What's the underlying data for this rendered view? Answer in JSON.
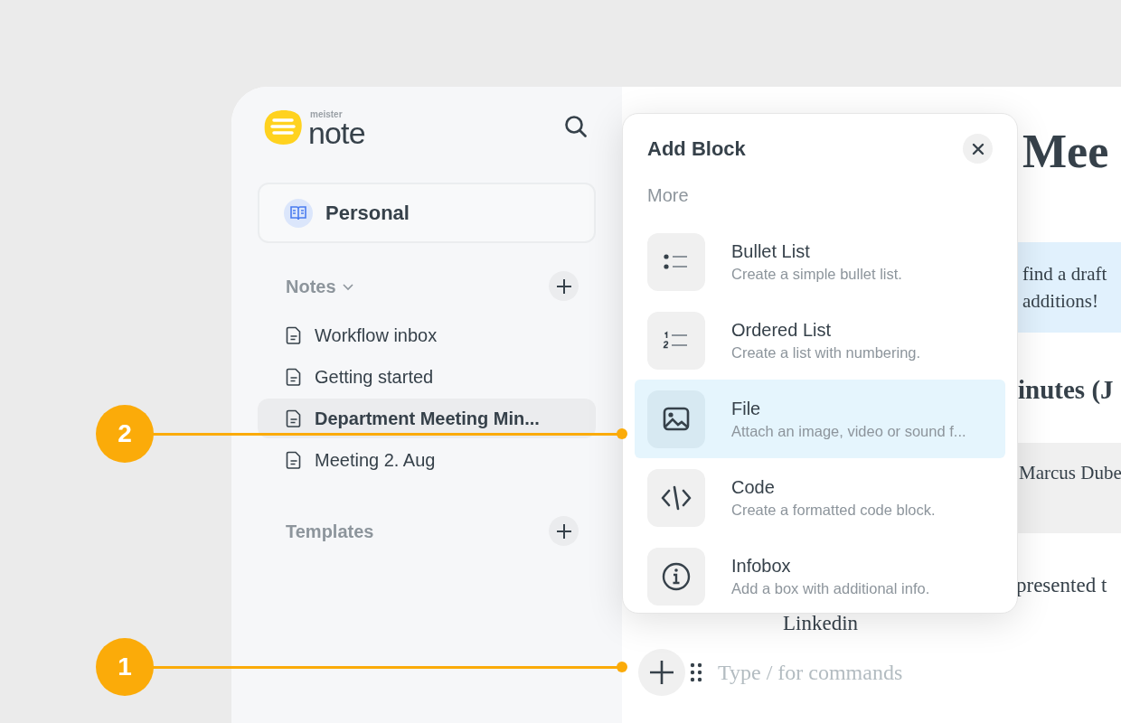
{
  "sidebar": {
    "logo": {
      "small": "meister",
      "large": "note"
    },
    "workspace": "Personal",
    "sections": [
      {
        "title": "Notes",
        "dropdown": true,
        "items": [
          {
            "label": "Workflow inbox",
            "selected": false
          },
          {
            "label": "Getting started",
            "selected": false
          },
          {
            "label": "Department Meeting Min...",
            "selected": true
          },
          {
            "label": "Meeting 2. Aug",
            "selected": false
          }
        ]
      },
      {
        "title": "Templates",
        "dropdown": false
      }
    ]
  },
  "popup": {
    "title": "Add Block",
    "section": "More",
    "items": [
      {
        "kind": "bullet",
        "title": "Bullet List",
        "description": "Create a simple bullet list.",
        "selected": false
      },
      {
        "kind": "ordered",
        "title": "Ordered List",
        "description": "Create a list with numbering.",
        "selected": false
      },
      {
        "kind": "file",
        "title": "File",
        "description": "Attach an image, video or sound f...",
        "selected": true
      },
      {
        "kind": "code",
        "title": "Code",
        "description": "Create a formatted code block.",
        "selected": false
      },
      {
        "kind": "info",
        "title": "Infobox",
        "description": "Add a box with additional info.",
        "selected": false
      }
    ]
  },
  "editor": {
    "title": "Mee",
    "infobox": [
      "find a draft",
      "additions!"
    ],
    "heading": "inutes (J",
    "table_cell": "Marcus Dube",
    "paragraph": "presented t",
    "line": "Linkedin",
    "placeholder": "Type / for commands"
  },
  "callouts": [
    {
      "label": "2"
    },
    {
      "label": "1"
    }
  ]
}
